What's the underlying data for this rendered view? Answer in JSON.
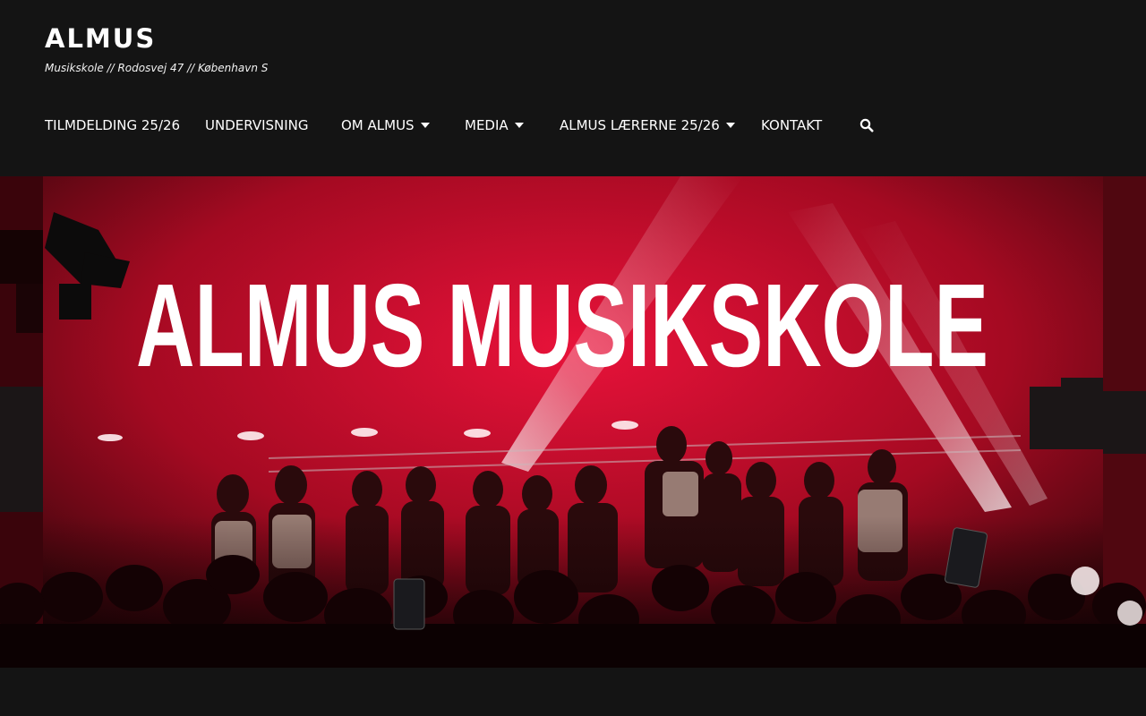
{
  "site": {
    "title": "ALMUS",
    "tagline": "Musikskole // Rodosvej 47 // København S"
  },
  "nav": {
    "items": [
      {
        "label": "TILMDELDING 25/26",
        "has_dropdown": false
      },
      {
        "label": "UNDERVISNING",
        "has_dropdown": false
      },
      {
        "label": "OM ALMUS",
        "has_dropdown": true
      },
      {
        "label": "MEDIA",
        "has_dropdown": true
      },
      {
        "label": "ALMUS LÆRERNE 25/26",
        "has_dropdown": true
      },
      {
        "label": "KONTAKT",
        "has_dropdown": false
      }
    ],
    "search_icon": "search-icon"
  },
  "hero": {
    "banner_text": "ALMUS MUSIKSKOLE"
  },
  "colors": {
    "background": "#141414",
    "text": "#ffffff",
    "hero_red": "#c8102e"
  }
}
